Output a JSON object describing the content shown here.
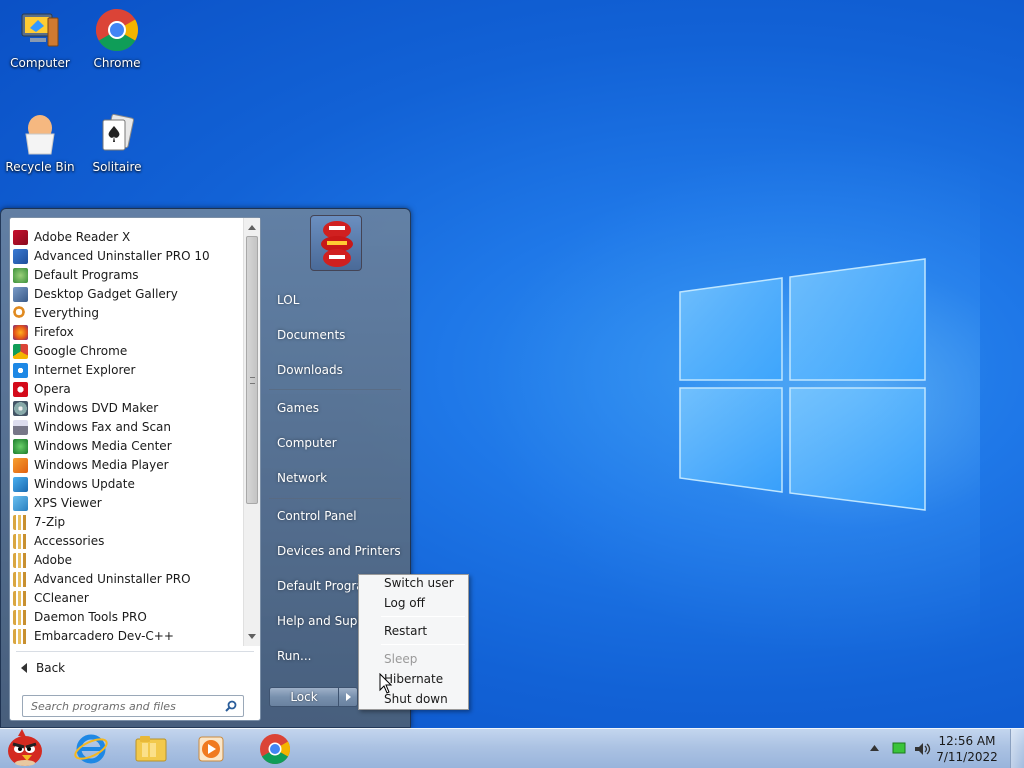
{
  "desktop": {
    "icons": [
      {
        "label": "Computer"
      },
      {
        "label": "Chrome"
      },
      {
        "label": "Recycle Bin"
      },
      {
        "label": "Solitaire"
      }
    ]
  },
  "start_menu": {
    "programs": [
      {
        "label": "Adobe Reader X",
        "icon": "adobe-reader-icon"
      },
      {
        "label": "Advanced Uninstaller PRO 10",
        "icon": "uninstaller-icon"
      },
      {
        "label": "Default Programs",
        "icon": "default-programs-icon"
      },
      {
        "label": "Desktop Gadget Gallery",
        "icon": "gadget-icon"
      },
      {
        "label": "Everything",
        "icon": "magnifier-icon"
      },
      {
        "label": "Firefox",
        "icon": "firefox-icon"
      },
      {
        "label": "Google Chrome",
        "icon": "chrome-icon"
      },
      {
        "label": "Internet Explorer",
        "icon": "ie-icon"
      },
      {
        "label": "Opera",
        "icon": "opera-icon"
      },
      {
        "label": "Windows DVD Maker",
        "icon": "dvd-icon"
      },
      {
        "label": "Windows Fax and Scan",
        "icon": "fax-icon"
      },
      {
        "label": "Windows Media Center",
        "icon": "media-center-icon"
      },
      {
        "label": "Windows Media Player",
        "icon": "media-player-icon"
      },
      {
        "label": "Windows Update",
        "icon": "windows-update-icon"
      },
      {
        "label": "XPS Viewer",
        "icon": "xps-icon"
      },
      {
        "label": "7-Zip",
        "icon": "folder-icon"
      },
      {
        "label": "Accessories",
        "icon": "folder-icon"
      },
      {
        "label": "Adobe",
        "icon": "folder-icon"
      },
      {
        "label": "Advanced Uninstaller PRO",
        "icon": "folder-icon"
      },
      {
        "label": "CCleaner",
        "icon": "folder-icon"
      },
      {
        "label": "Daemon Tools PRO",
        "icon": "folder-icon"
      },
      {
        "label": "Embarcadero Dev-C++",
        "icon": "folder-icon"
      }
    ],
    "back_label": "Back",
    "search_placeholder": "Search programs and files",
    "right_items": [
      {
        "label": "LOL"
      },
      {
        "label": "Documents"
      },
      {
        "label": "Downloads"
      },
      {
        "label": "Games"
      },
      {
        "label": "Computer"
      },
      {
        "label": "Network"
      },
      {
        "label": "Control Panel"
      },
      {
        "label": "Devices and Printers"
      },
      {
        "label": "Default Programs"
      },
      {
        "label": "Help and Support"
      },
      {
        "label": "Run..."
      }
    ],
    "lock_label": "Lock"
  },
  "power_menu": {
    "switch_user": "Switch user",
    "log_off": "Log off",
    "restart": "Restart",
    "sleep": "Sleep",
    "hibernate": "Hibernate",
    "shut_down": "Shut down"
  },
  "taskbar": {
    "time": "12:56 AM",
    "date": "7/11/2022"
  },
  "colors": {
    "desktop": "#1f78e8",
    "taskbar": "#b4c8e4"
  }
}
